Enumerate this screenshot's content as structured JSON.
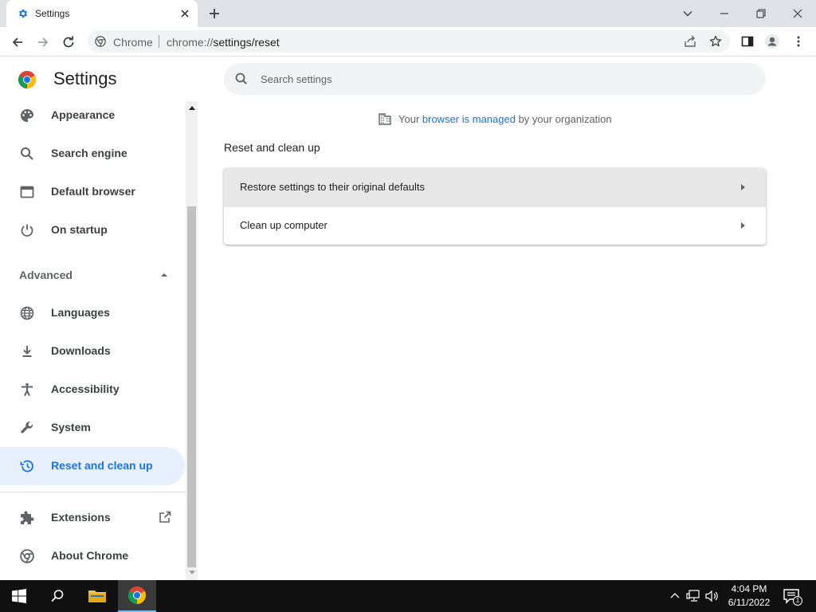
{
  "browser": {
    "tab": {
      "title": "Settings",
      "favicon": "gear-icon",
      "close": "close-icon"
    },
    "new_tab": "plus-icon",
    "window_controls": [
      "chevron-down-icon",
      "minimize-icon",
      "restore-icon",
      "close-icon"
    ],
    "omnibox": {
      "site_name": "Chrome",
      "url_host": "chrome://",
      "url_path": "settings/reset",
      "site_icon": "chrome-icon"
    },
    "toolbar_icons": [
      "share-icon",
      "star-icon",
      "side-panel-icon",
      "profile-icon",
      "kebab-menu-icon"
    ]
  },
  "settings": {
    "title": "Settings",
    "search_placeholder": "Search settings",
    "sidebar": {
      "items_top": [
        {
          "label": "Appearance",
          "icon": "palette-icon"
        },
        {
          "label": "Search engine",
          "icon": "search-icon"
        },
        {
          "label": "Default browser",
          "icon": "browser-window-icon"
        },
        {
          "label": "On startup",
          "icon": "power-icon"
        }
      ],
      "advanced_label": "Advanced",
      "items_advanced": [
        {
          "label": "Languages",
          "icon": "globe-icon"
        },
        {
          "label": "Downloads",
          "icon": "download-icon"
        },
        {
          "label": "Accessibility",
          "icon": "accessibility-icon"
        },
        {
          "label": "System",
          "icon": "wrench-icon"
        },
        {
          "label": "Reset and clean up",
          "icon": "history-icon",
          "active": true
        }
      ],
      "items_bottom": [
        {
          "label": "Extensions",
          "icon": "puzzle-icon"
        },
        {
          "label": "About Chrome",
          "icon": "chrome-icon"
        }
      ]
    },
    "managed_notice": {
      "prefix": "Your ",
      "link": "browser is managed",
      "suffix": " by your organization"
    },
    "section_title": "Reset and clean up",
    "rows": [
      {
        "label": "Restore settings to their original defaults"
      },
      {
        "label": "Clean up computer"
      }
    ]
  },
  "taskbar": {
    "time": "4:04 PM",
    "date": "6/11/2022",
    "notification_count": "1"
  },
  "colors": {
    "accent": "#1a73e8",
    "active_bg": "#e8f0fe",
    "tabstrip": "#dee1e6"
  }
}
